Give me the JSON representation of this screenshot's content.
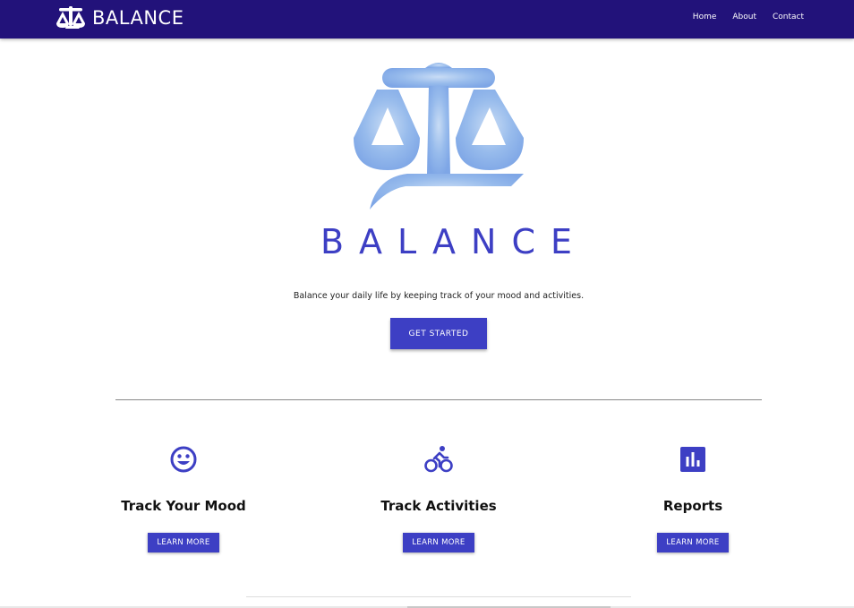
{
  "navbar": {
    "brand": "BALANCE",
    "links": [
      "Home",
      "About",
      "Contact"
    ],
    "background": "#22127a"
  },
  "hero": {
    "title": "BALANCE",
    "tagline": "Balance your daily life by keeping track of your mood and activities.",
    "cta_label": "GET STARTED",
    "accent": "#3d3fc4",
    "logo_color": "#8fb3ea"
  },
  "features": [
    {
      "icon": "smiley-face-icon",
      "title": "Track Your Mood",
      "button": "LEARN MORE"
    },
    {
      "icon": "bicycle-icon",
      "title": "Track Activities",
      "button": "LEARN MORE"
    },
    {
      "icon": "bar-chart-icon",
      "title": "Reports",
      "button": "LEARN MORE"
    }
  ]
}
